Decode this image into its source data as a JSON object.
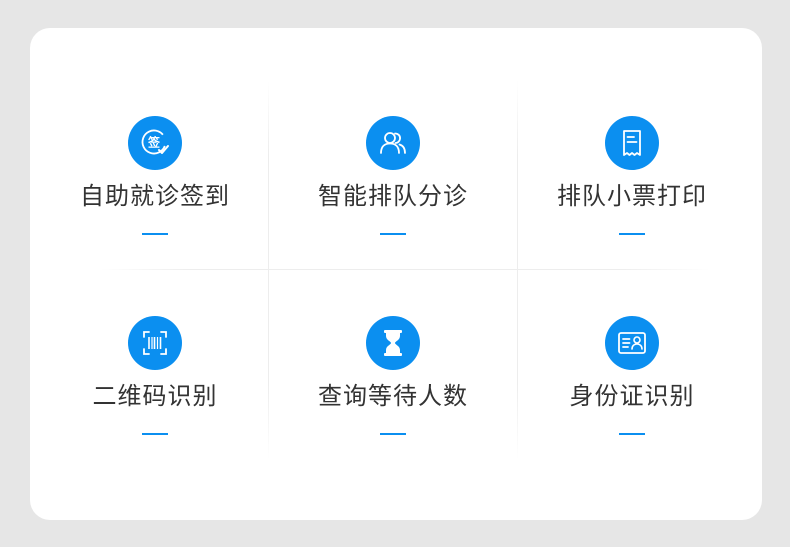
{
  "theme": {
    "accent": "#0b8ff0",
    "text": "#333333",
    "background": "#e6e6e6",
    "card": "#ffffff"
  },
  "features": [
    {
      "label": "自助就诊签到",
      "icon": "sign-in-check-icon",
      "icon_char": "签"
    },
    {
      "label": "智能排队分诊",
      "icon": "users-icon"
    },
    {
      "label": "排队小票打印",
      "icon": "receipt-icon"
    },
    {
      "label": "二维码识别",
      "icon": "barcode-scan-icon"
    },
    {
      "label": "查询等待人数",
      "icon": "hourglass-icon"
    },
    {
      "label": "身份证识别",
      "icon": "id-card-icon"
    }
  ]
}
